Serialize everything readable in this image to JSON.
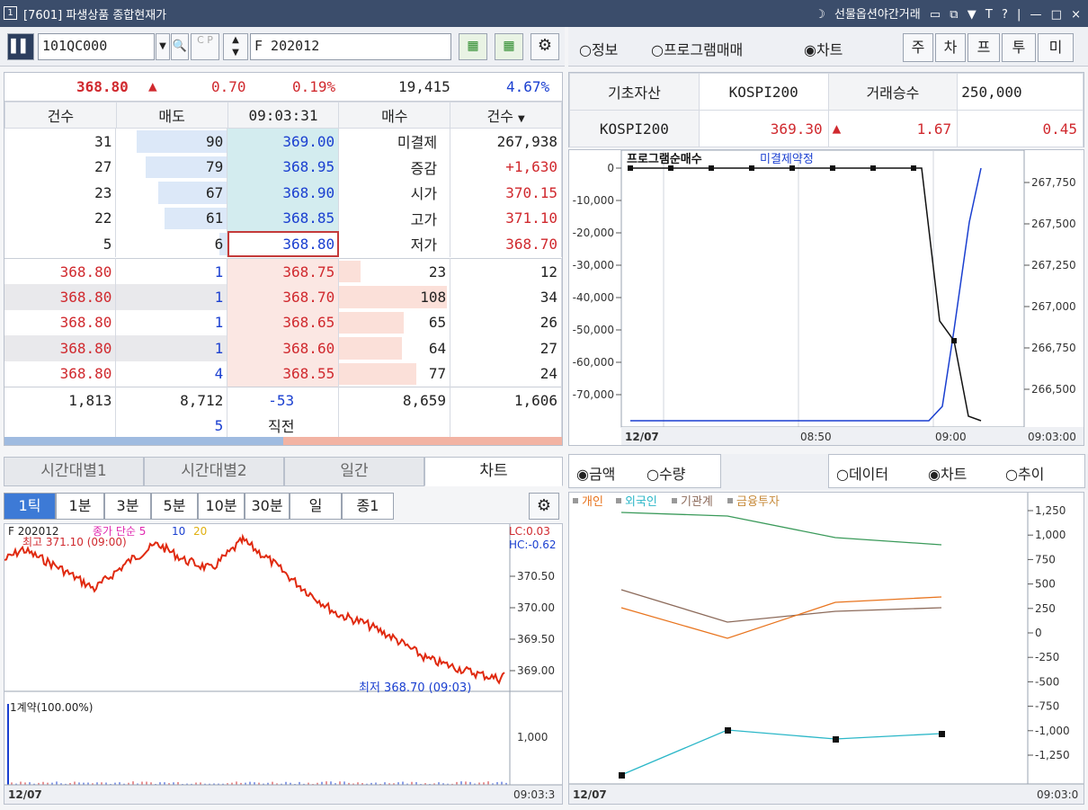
{
  "title": {
    "window_no": "1",
    "text": "[7601] 파생상품 종합현재가",
    "right_label": "선물옵션야간거래",
    "controls": [
      "▭",
      "⧉",
      "▼",
      "T",
      "?",
      "|",
      "—",
      "□",
      "×"
    ]
  },
  "toolbar": {
    "code": "101QC000",
    "cp_label": "C P",
    "product": "F 202012"
  },
  "right_toolbar": {
    "radios": [
      {
        "label": "○정보"
      },
      {
        "label": "○프로그램매매"
      },
      {
        "label": "◉차트"
      }
    ],
    "buttons": [
      "주",
      "차",
      "프",
      "투",
      "미"
    ]
  },
  "quote": {
    "price": "368.80",
    "arrow": "▲",
    "change": "0.70",
    "rate": "0.19%",
    "volume": "19,415",
    "pct": "4.67%"
  },
  "orderbook": {
    "headers": [
      "건수",
      "매도",
      "09:03:31",
      "매수",
      "건수"
    ],
    "asks": [
      {
        "cnt": "31",
        "qty": "90",
        "price": "369.00"
      },
      {
        "cnt": "27",
        "qty": "79",
        "price": "368.95"
      },
      {
        "cnt": "23",
        "qty": "67",
        "price": "368.90"
      },
      {
        "cnt": "22",
        "qty": "61",
        "price": "368.85"
      },
      {
        "cnt": "5",
        "qty": "6",
        "price": "368.80"
      }
    ],
    "info": [
      {
        "label": "미결제",
        "value": "267,938"
      },
      {
        "label": "증감",
        "value": "+1,630"
      },
      {
        "label": "시가",
        "value": "370.15"
      },
      {
        "label": "고가",
        "value": "371.10"
      },
      {
        "label": "저가",
        "value": "368.70"
      }
    ],
    "ticks": [
      {
        "price": "368.80",
        "qty": "1"
      },
      {
        "price": "368.80",
        "qty": "1"
      },
      {
        "price": "368.80",
        "qty": "1"
      },
      {
        "price": "368.80",
        "qty": "1"
      },
      {
        "price": "368.80",
        "qty": "4"
      }
    ],
    "bids": [
      {
        "price": "368.75",
        "qty": "23",
        "cnt": "12"
      },
      {
        "price": "368.70",
        "qty": "108",
        "cnt": "34"
      },
      {
        "price": "368.65",
        "qty": "65",
        "cnt": "26"
      },
      {
        "price": "368.60",
        "qty": "64",
        "cnt": "27"
      },
      {
        "price": "368.55",
        "qty": "77",
        "cnt": "24"
      }
    ],
    "totals": {
      "ask_cnt": "1,813",
      "ask_qty": "8,712",
      "diff": "-53",
      "bid_qty": "8,659",
      "bid_cnt": "1,606"
    },
    "last": {
      "qty": "5",
      "label": "직전"
    }
  },
  "underlying": {
    "label1": "기초자산",
    "value1": "KOSPI200",
    "label2": "거래승수",
    "value2": "250,000",
    "label3": "KOSPI200",
    "price": "369.30",
    "arrow": "▲",
    "change": "1.67",
    "rate": "0.45"
  },
  "program_chart": {
    "legend": [
      "프로그램순매수",
      "미결제약정"
    ],
    "left_ticks": [
      "0",
      "-10,000",
      "-20,000",
      "-30,000",
      "-40,000",
      "-50,000",
      "-60,000",
      "-70,000"
    ],
    "right_ticks": [
      "267,750",
      "267,500",
      "267,250",
      "267,000",
      "266,750",
      "266,500"
    ],
    "x_labels": [
      "12/07",
      "08:50",
      "09:00",
      "09:03:00"
    ]
  },
  "lower_tabs": [
    "시간대별1",
    "시간대별2",
    "일간",
    "차트"
  ],
  "period_tabs": [
    "1틱",
    "1분",
    "3분",
    "5분",
    "10분",
    "30분",
    "일",
    "종1"
  ],
  "price_chart": {
    "legend": {
      "name": "F 202012",
      "ma": "종가 단순 5",
      "p10": "10",
      "p20": "20"
    },
    "high_label": "최고 371.10 (09:00)",
    "low_label": "최저 368.70 (09:03)",
    "lc": "LC:0.03",
    "hc": "HC:-0.62",
    "ticks": [
      "370.50",
      "370.00",
      "369.50",
      "369.00"
    ],
    "vol_label": "1계약(100.00%)",
    "vol_tick": "1,000",
    "x_left": "12/07",
    "x_right": "09:03:3"
  },
  "investor": {
    "radio_amount": "◉금액",
    "radio_qty": "○수량",
    "radio_data": "○데이터",
    "radio_chart": "◉차트",
    "radio_trend": "○추이",
    "legend": [
      {
        "name": "개인",
        "color": "#e8741e"
      },
      {
        "name": "외국인",
        "color": "#2bb7c8"
      },
      {
        "name": "기관계",
        "color": "#8c6a5a"
      },
      {
        "name": "금융투자",
        "color": "#c78a3a"
      }
    ],
    "ticks": [
      "1,250",
      "1,000",
      "750",
      "500",
      "250",
      "0",
      "-250",
      "-500",
      "-750",
      "-1,000",
      "-1,250"
    ],
    "x_left": "12/07",
    "x_right": "09:03:0"
  },
  "colors": {
    "titlebar": "#3b4d6b",
    "up": "#d0292e",
    "down": "#1a3fd0"
  }
}
